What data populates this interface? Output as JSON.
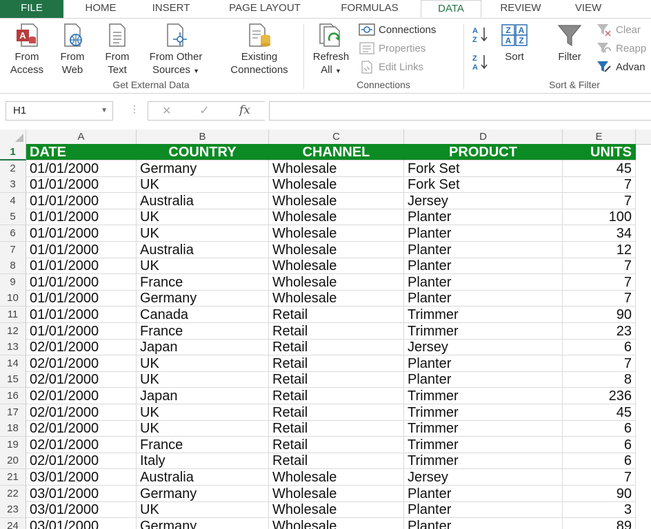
{
  "ribbon_tabs": [
    "FILE",
    "HOME",
    "INSERT",
    "PAGE LAYOUT",
    "FORMULAS",
    "DATA",
    "REVIEW",
    "VIEW"
  ],
  "active_tab": "DATA",
  "external_data": {
    "from_access": [
      "From",
      "Access"
    ],
    "from_web": [
      "From",
      "Web"
    ],
    "from_text": [
      "From",
      "Text"
    ],
    "from_other": [
      "From Other",
      "Sources"
    ],
    "existing": [
      "Existing",
      "Connections"
    ],
    "label": "Get External Data"
  },
  "connections": {
    "refresh": [
      "Refresh",
      "All"
    ],
    "connections": "Connections",
    "properties": "Properties",
    "edit_links": "Edit Links",
    "label": "Connections"
  },
  "sort_filter": {
    "sort": "Sort",
    "filter": "Filter",
    "clear": "Clear",
    "reapply": "Reapp",
    "advanced": "Advan",
    "label": "Sort & Filter"
  },
  "formula_bar": {
    "name_box": "H1",
    "cancel": "✕",
    "enter": "✓",
    "fx": "fx",
    "value": ""
  },
  "columns": [
    "A",
    "B",
    "C",
    "D",
    "E"
  ],
  "headers": [
    "DATE",
    "COUNTRY",
    "CHANNEL",
    "PRODUCT",
    "UNITS"
  ],
  "rows": [
    [
      "01/01/2000",
      "Germany",
      "Wholesale",
      "Fork Set",
      "45"
    ],
    [
      "01/01/2000",
      "UK",
      "Wholesale",
      "Fork Set",
      "7"
    ],
    [
      "01/01/2000",
      "Australia",
      "Wholesale",
      "Jersey",
      "7"
    ],
    [
      "01/01/2000",
      "UK",
      "Wholesale",
      "Planter",
      "100"
    ],
    [
      "01/01/2000",
      "UK",
      "Wholesale",
      "Planter",
      "34"
    ],
    [
      "01/01/2000",
      "Australia",
      "Wholesale",
      "Planter",
      "12"
    ],
    [
      "01/01/2000",
      "UK",
      "Wholesale",
      "Planter",
      "7"
    ],
    [
      "01/01/2000",
      "France",
      "Wholesale",
      "Planter",
      "7"
    ],
    [
      "01/01/2000",
      "Germany",
      "Wholesale",
      "Planter",
      "7"
    ],
    [
      "01/01/2000",
      "Canada",
      "Retail",
      "Trimmer",
      "90"
    ],
    [
      "01/01/2000",
      "France",
      "Retail",
      "Trimmer",
      "23"
    ],
    [
      "02/01/2000",
      "Japan",
      "Retail",
      "Jersey",
      "6"
    ],
    [
      "02/01/2000",
      "UK",
      "Retail",
      "Planter",
      "7"
    ],
    [
      "02/01/2000",
      "UK",
      "Retail",
      "Planter",
      "8"
    ],
    [
      "02/01/2000",
      "Japan",
      "Retail",
      "Trimmer",
      "236"
    ],
    [
      "02/01/2000",
      "UK",
      "Retail",
      "Trimmer",
      "45"
    ],
    [
      "02/01/2000",
      "UK",
      "Retail",
      "Trimmer",
      "6"
    ],
    [
      "02/01/2000",
      "France",
      "Retail",
      "Trimmer",
      "6"
    ],
    [
      "02/01/2000",
      "Italy",
      "Retail",
      "Trimmer",
      "6"
    ],
    [
      "03/01/2000",
      "Australia",
      "Wholesale",
      "Jersey",
      "7"
    ],
    [
      "03/01/2000",
      "Germany",
      "Wholesale",
      "Planter",
      "90"
    ],
    [
      "03/01/2000",
      "UK",
      "Wholesale",
      "Planter",
      "3"
    ],
    [
      "03/01/2000",
      "Germany",
      "Wholesale",
      "Planter",
      "89"
    ]
  ],
  "colors": {
    "accent": "#217346",
    "header_fill": "#0c8a23",
    "header_text": "#ffffff"
  }
}
